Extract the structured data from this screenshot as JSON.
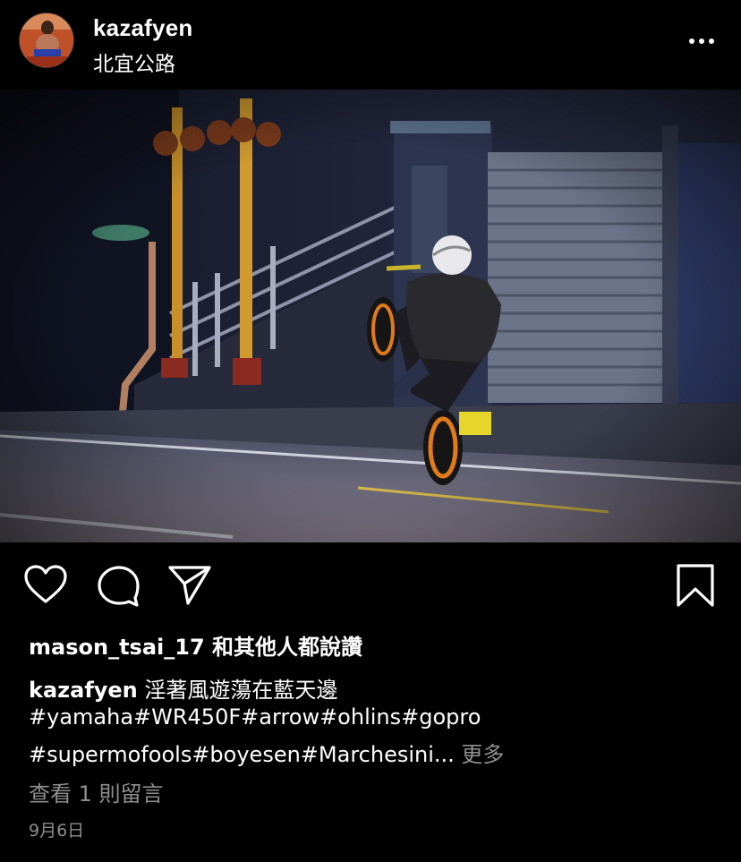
{
  "post": {
    "username": "kazafyen",
    "location": "北宜公路",
    "more_icon": "more-horizontal-icon"
  },
  "actions": {
    "like_icon": "heart-icon",
    "comment_icon": "comment-icon",
    "share_icon": "send-icon",
    "save_icon": "bookmark-icon"
  },
  "likes": {
    "text": "mason_tsai_17 和其他人都說讚"
  },
  "caption": {
    "username": "kazafyen",
    "text": "淫著風遊蕩在藍天邊",
    "tags_line1": "#yamaha#WR450F#arrow#ohlins#gopro",
    "tags_line2": "#supermofools#boyesen#Marchesini...",
    "more": "更多"
  },
  "comments": {
    "text": "查看 1 則留言"
  },
  "date": "9月6日"
}
